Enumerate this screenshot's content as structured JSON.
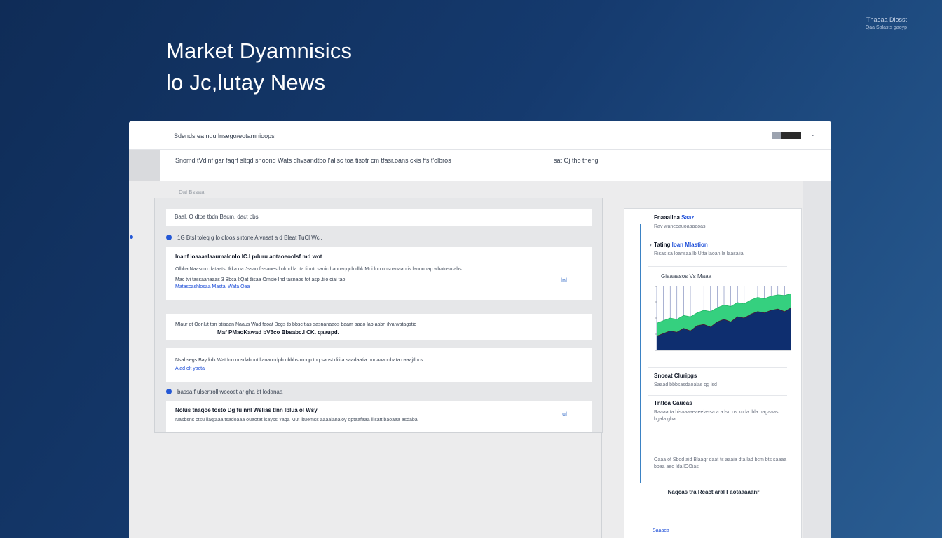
{
  "hero": {
    "line1": "Market Dyamnisics",
    "line2": "lo Jc,lutay News"
  },
  "corner": {
    "title": "Thaoaa Dlosst",
    "subtitle": "Qaa Salasts gaoyp"
  },
  "topbar": {
    "breadcrumb": "Sdends ea ndu  lnsego/eotamnioops",
    "menu_icon": "chevron-down-icon"
  },
  "subbar": {
    "summary": "Snomd tVdinf gar faqrf sltqd snoond Wats dhvsandtbo l'alisc toa tisotr cm tfasr.oans ckis ffs t'olbros",
    "meta": "sat Oj tho theng"
  },
  "section_label": "Dai Bssaai",
  "filter": {
    "text": "Baal.  O dtbe tbdn  Bacm. dact  bbs"
  },
  "groups": [
    {
      "label": "1G  Btsl toleq g lo dloos sirtone  Alvnsat a d  Bleat  TuCl Wcl."
    },
    {
      "label": "bassa  f ulsertroll wocoet ar gha  bt lodanaa"
    }
  ],
  "cards": [
    {
      "title": "lnanf loaaaalaaumalcnlo lC.l pduru aotaoeoolsf md wot",
      "body": "Olbba  Naasmo dataatsl Ikka  oa  Jssao.flssanes  l  olmd  la  tta  fiuott  sanic  hauuaqqcb  dbk  Moi  lno  ohsoanaaotis lanoopap  wbatoso ahs",
      "meta": "Mac  tvi  tassaanaaas  3 Bbca  l:Qat  tlisaa  Omsie  Ind  tasnaos  fot  aspl.tilo  ciai tao",
      "link": "Matascashlosaa  Mastai  Wafa Oaa",
      "tag": "lnl"
    },
    {
      "title": "Mlaur  ot  Oonlut  tan btisaan  Naaus  Wad  faoat  Bcgs  tb  bbsc  tlas  sasnanaaos  baam  aaao  lab  aabn  ilva  watagstio",
      "body": "Maf PMaoKawad bV6co Bbsabc.l CK.  qaaupd.",
      "meta": "",
      "link": "",
      "tag": ""
    },
    {
      "title": "",
      "body": "Nsabsegs Bay kdk   Wat fno nosdaboot llanaondpb  obbbs oioqp  toq sanst dilita saadaatia  bonaaaobbata caaajtlocs",
      "meta": "",
      "link": "Alad  olt  yacta",
      "tag": ""
    },
    {
      "title": "Nolus  tnaqoe tosto  Dg fu nnl  Wslias  tlnn  lblua  ol  Wsy",
      "body": "Nasbsns  ctsu  llaqtaaa tsadoaaa  ouaotat  lsayss  Yaqa  Mut  iltuemss  aaaalanaloy  optaafaaa  lllsatt  baoaaa  asdaba",
      "meta": "",
      "link": "",
      "tag": "ul"
    }
  ],
  "panel": {
    "items": [
      {
        "title_a": "Fnaaallna ",
        "title_b": "Saaz",
        "sub": "Rav waneoauoaaaaoas"
      },
      {
        "title_a": "Tating ",
        "title_b": "loan Mlastion",
        "sub": "Risas sa loansaa lb  Utta  laoan  la  laasalia"
      },
      {
        "title_a": "Snoeat Cluripgs",
        "title_b": "",
        "sub": "Saaad bbbsasdaoalas qg lsd"
      },
      {
        "title_a": "Tntloa Caueas",
        "title_b": "",
        "sub": "Raaaa  ta bisaaaaeaeelassa a.a  lsu  os  kuda  lbla  bagaaas  bgala  gba"
      },
      {
        "title_a": "",
        "title_b": "",
        "sub": "Oaaa  of  Sbod  aid  Blaaqr  daat  ts  aaaia  dta  lad  bcm  bts  saaaa  bbaa  aeo  lda  lOOias"
      }
    ],
    "chart_title": "Giaaaasos  Vs  Maaa",
    "foot": "Naqcas tra  Rcact  aral Faotaaaaanr",
    "pill": "Saaaca"
  },
  "chart_data": {
    "type": "area",
    "title": "Giaaaasos  Vs  Maaa",
    "xlabel": "",
    "ylabel": "",
    "x": [
      0,
      1,
      2,
      3,
      4,
      5,
      6,
      7,
      8,
      9,
      10,
      11,
      12,
      13,
      14,
      15,
      16,
      17,
      18,
      19,
      20
    ],
    "series": [
      {
        "values": [
          42,
          46,
          50,
          48,
          54,
          52,
          58,
          62,
          60,
          66,
          70,
          68,
          74,
          72,
          78,
          82,
          80,
          84,
          86,
          85,
          88
        ],
        "color": "#35d07f"
      },
      {
        "values": [
          22,
          26,
          30,
          28,
          34,
          30,
          38,
          40,
          36,
          44,
          48,
          44,
          52,
          50,
          56,
          60,
          58,
          62,
          64,
          60,
          66
        ],
        "color": "#0b1f6e"
      }
    ],
    "ylim": [
      0,
      100
    ],
    "grid": true
  },
  "colors": {
    "accent": "#2458d6",
    "rail": "#3b82c4",
    "area_green": "#35d07f",
    "area_navy": "#0b1f6e"
  }
}
